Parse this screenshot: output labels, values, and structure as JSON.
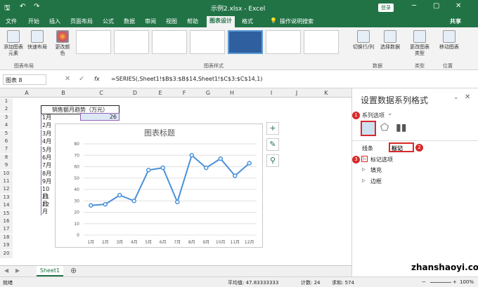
{
  "window": {
    "title": "示例2.xlsx - Excel",
    "login": "登录",
    "share": "共享",
    "tell_me": "操作说明搜索"
  },
  "tabs": [
    "文件",
    "开始",
    "插入",
    "页面布局",
    "公式",
    "数据",
    "审阅",
    "视图",
    "帮助",
    "图表设计",
    "格式"
  ],
  "ribbon": {
    "add_element": "添加图表元素",
    "quick_layout": "快速布局",
    "group_layout": "图表布局",
    "change_color": "更改颜色",
    "group_styles": "图表样式",
    "switch_row_col": "切换行/列",
    "select_data": "选择数据",
    "group_data": "数据",
    "change_type": "更改图表类型",
    "group_type": "类型",
    "move_chart": "移动图表",
    "group_location": "位置"
  },
  "formula_bar": {
    "name_box": "图表 8",
    "fx": "fx",
    "formula": "=SERIES(,Sheet1!$B$3:$B$14,Sheet1!$C$3:$C$14,1)"
  },
  "columns": [
    "A",
    "B",
    "C",
    "D",
    "E",
    "F",
    "G",
    "H",
    "I",
    "J",
    "K"
  ],
  "rows": [
    "1",
    "2",
    "3",
    "4",
    "5",
    "6",
    "7",
    "8",
    "9",
    "10",
    "11",
    "12",
    "13",
    "14",
    "15",
    "16",
    "17",
    "18",
    "19",
    "20"
  ],
  "table": {
    "header": "销售额月趋势（万元）",
    "months": [
      "1月",
      "2月",
      "3月",
      "4月",
      "5月",
      "6月",
      "7月",
      "8月",
      "9月",
      "10月",
      "11月",
      "12月"
    ],
    "first_value": "26"
  },
  "chart_data": {
    "type": "line",
    "title": "图表标题",
    "categories": [
      "1月",
      "2月",
      "3月",
      "4月",
      "5月",
      "6月",
      "7月",
      "8月",
      "9月",
      "10月",
      "11月",
      "12月"
    ],
    "values": [
      26,
      27,
      35,
      30,
      57,
      59,
      29,
      70,
      59,
      67,
      52,
      63
    ],
    "ylim": [
      0,
      80
    ],
    "yticks": [
      "0",
      "10",
      "20",
      "30",
      "40",
      "50",
      "60",
      "70",
      "80"
    ],
    "color": "#4a90d9",
    "grid": true
  },
  "sheet": {
    "tab": "Sheet1"
  },
  "status": {
    "mode": "就绪",
    "average": "平均值: 47.83333333",
    "count": "计数: 24",
    "sum": "求和: 574",
    "zoom": "100%"
  },
  "pane": {
    "title": "设置数据系列格式",
    "series_options": "系列选项",
    "line_tab": "线条",
    "marker_tab": "标记",
    "marker_options": "标记选项",
    "fill": "填充",
    "border": "边框",
    "badges": [
      "1",
      "2",
      "3"
    ]
  },
  "watermark": "zhanshaoyi.com"
}
